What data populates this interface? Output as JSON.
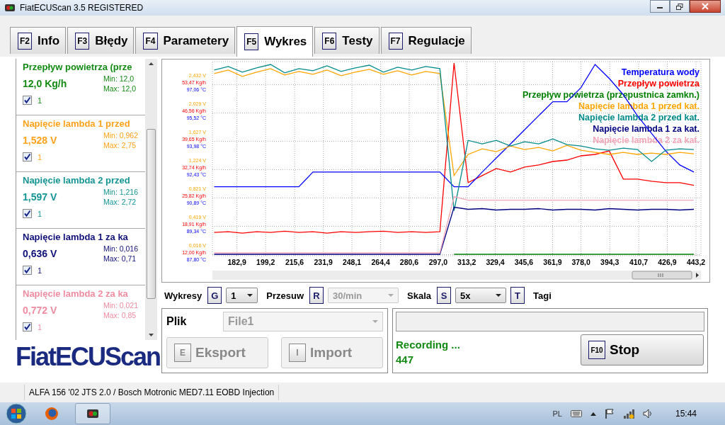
{
  "window": {
    "title": "FiatECUScan 3.5 REGISTERED"
  },
  "tabs": [
    {
      "key": "F2",
      "label": "Info",
      "selected": false
    },
    {
      "key": "F3",
      "label": "Błędy",
      "selected": false
    },
    {
      "key": "F4",
      "label": "Parametery",
      "selected": false
    },
    {
      "key": "F5",
      "label": "Wykres",
      "selected": true
    },
    {
      "key": "F6",
      "label": "Testy",
      "selected": false
    },
    {
      "key": "F7",
      "label": "Regulacje",
      "selected": false
    }
  ],
  "parameters": [
    {
      "name": "Przepływ powietrza (prze",
      "value": "12,0 Kg/h",
      "min": "Min: 12,0",
      "max": "Max: 12,0",
      "checked": true,
      "index": "1",
      "color": "#138a13"
    },
    {
      "name": "Napięcie lambda 1 przed",
      "value": "1,528 V",
      "min": "Min: 0,962",
      "max": "Max: 2,75",
      "checked": true,
      "index": "1",
      "color": "#ffa21a"
    },
    {
      "name": "Napięcie lambda 2 przed",
      "value": "1,597 V",
      "min": "Min: 1,216",
      "max": "Max: 2,72",
      "checked": true,
      "index": "1",
      "color": "#149494"
    },
    {
      "name": "Napięcie lambda 1 za ka",
      "value": "0,636 V",
      "min": "Min: 0,016",
      "max": "Max: 0,71",
      "checked": true,
      "index": "1",
      "color": "#10107a"
    },
    {
      "name": "Napięcie lambda 2 za ka",
      "value": "0,772 V",
      "min": "Min: 0,021",
      "max": "Max: 0,85",
      "checked": true,
      "index": "1",
      "color": "#f08ca0"
    }
  ],
  "logo": "FiatECUScan",
  "chart": {
    "chart_data": {
      "type": "line",
      "x": [
        170,
        178,
        186,
        194,
        202,
        210,
        218,
        226,
        234,
        242,
        250,
        258,
        266,
        274,
        282,
        290,
        298,
        306,
        314,
        322,
        330,
        338,
        346,
        354,
        362,
        370,
        378,
        386,
        394,
        402,
        410,
        418,
        426,
        434,
        442
      ],
      "series": [
        {
          "name": "Temperatura wody",
          "color": "#0000ff",
          "values": [
            0.84,
            0.84,
            0.84,
            0.84,
            0.84,
            0.84,
            0.84,
            1.05,
            1.05,
            1.05,
            1.05,
            1.05,
            1.05,
            1.05,
            1.05,
            1.05,
            1.05,
            0.84,
            0.84,
            1.05,
            1.25,
            1.45,
            1.65,
            1.85,
            2.05,
            2.05,
            2.25,
            2.58,
            2.38,
            2.15,
            1.85,
            1.6,
            1.35,
            1.15,
            1.05
          ]
        },
        {
          "name": "Przepływ powietrza",
          "color": "#ff0000",
          "values": [
            0.19,
            0.2,
            0.18,
            0.2,
            0.19,
            0.21,
            0.19,
            0.2,
            0.18,
            0.2,
            0.19,
            0.2,
            0.21,
            0.19,
            0.2,
            0.19,
            0.2,
            2.6,
            0.9,
            1.0,
            1.1,
            1.05,
            1.12,
            1.15,
            1.2,
            1.22,
            1.28,
            1.3,
            1.35,
            0.95,
            0.95,
            0.92,
            0.9,
            0.9,
            0.86
          ]
        },
        {
          "name": "Przepływ powietrza (przepustnica zamkn.)",
          "color": "#008000",
          "values": [
            null,
            null,
            null,
            null,
            null,
            null,
            null,
            null,
            null,
            null,
            null,
            null,
            null,
            null,
            null,
            null,
            null,
            -0.12,
            -0.12,
            -0.12,
            -0.12,
            -0.12,
            -0.12,
            -0.12,
            -0.12,
            -0.12,
            -0.12,
            -0.12,
            -0.12,
            -0.12,
            -0.12,
            -0.12,
            -0.12,
            -0.12,
            -0.12
          ]
        },
        {
          "name": "Napięcie lambda 1 przed kat.",
          "color": "#ffa500",
          "values": [
            2.45,
            2.5,
            2.41,
            2.47,
            2.52,
            2.43,
            2.48,
            2.44,
            2.5,
            2.42,
            2.47,
            2.51,
            2.44,
            2.49,
            2.43,
            2.48,
            2.45,
            1.0,
            1.3,
            1.38,
            1.34,
            1.42,
            1.37,
            1.4,
            1.35,
            1.43,
            1.36,
            1.33,
            1.3,
            1.33,
            1.3,
            1.32,
            1.3,
            1.33,
            1.31
          ]
        },
        {
          "name": "Napięcie lambda 2 przed kat.",
          "color": "#008b8b",
          "values": [
            2.5,
            2.55,
            2.47,
            2.53,
            2.58,
            2.46,
            2.52,
            2.49,
            2.56,
            2.48,
            2.53,
            2.57,
            2.47,
            2.54,
            2.5,
            2.55,
            2.52,
            0.5,
            1.5,
            1.45,
            1.5,
            1.42,
            1.48,
            1.45,
            1.52,
            1.44,
            1.42,
            1.38,
            1.36,
            1.39,
            1.37,
            1.2,
            1.36,
            1.38,
            1.37
          ]
        },
        {
          "name": "Napięcie lambda 1 za kat.",
          "color": "#000080",
          "values": [
            -0.12,
            -0.12,
            -0.12,
            -0.12,
            -0.12,
            -0.12,
            -0.12,
            -0.12,
            -0.12,
            -0.12,
            -0.12,
            -0.12,
            -0.12,
            -0.12,
            -0.12,
            -0.12,
            -0.12,
            0.55,
            0.52,
            0.53,
            0.51,
            0.52,
            0.52,
            0.53,
            0.51,
            0.52,
            0.52,
            0.51,
            0.53,
            0.52,
            0.51,
            0.52,
            0.52,
            0.51,
            0.52
          ]
        },
        {
          "name": "Napięcie lambda 2 za kat.",
          "color": "#f4a6b8",
          "values": [
            -0.1,
            -0.1,
            -0.1,
            -0.1,
            -0.1,
            -0.1,
            -0.1,
            -0.1,
            -0.1,
            -0.1,
            -0.1,
            -0.1,
            -0.1,
            -0.1,
            -0.1,
            -0.1,
            -0.1,
            0.7,
            0.65,
            0.65,
            0.65,
            0.65,
            0.65,
            0.65,
            0.65,
            0.65,
            0.65,
            0.65,
            0.65,
            0.65,
            0.65,
            0.65,
            0.65,
            0.65,
            0.65
          ]
        }
      ],
      "grid": true,
      "xlim": [
        169,
        446
      ],
      "ylim": [
        -0.14,
        2.62
      ],
      "xticks": [
        {
          "value": 182.9,
          "label": "182,9"
        },
        {
          "value": 199.2,
          "label": "199,2"
        },
        {
          "value": 215.6,
          "label": "215,6"
        },
        {
          "value": 231.9,
          "label": "231,9"
        },
        {
          "value": 248.1,
          "label": "248,1"
        },
        {
          "value": 264.4,
          "label": "264,4"
        },
        {
          "value": 280.6,
          "label": "280,6"
        },
        {
          "value": 297.0,
          "label": "297,0"
        },
        {
          "value": 313.2,
          "label": "313,2"
        },
        {
          "value": 329.4,
          "label": "329,4"
        },
        {
          "value": 345.6,
          "label": "345,6"
        },
        {
          "value": 361.9,
          "label": "361,9"
        },
        {
          "value": 378.0,
          "label": "378,0"
        },
        {
          "value": 394.3,
          "label": "394,3"
        },
        {
          "value": 410.7,
          "label": "410,7"
        },
        {
          "value": 426.9,
          "label": "426,9"
        },
        {
          "value": 443.2,
          "label": "443,2"
        }
      ],
      "yticks": [
        {
          "value": 2.432,
          "label": "2,432 V"
        },
        {
          "value": 2.029,
          "label": "2,029 V"
        },
        {
          "value": 1.627,
          "label": "1,627 V"
        },
        {
          "value": 1.224,
          "label": "1,224 V"
        },
        {
          "value": 0.821,
          "label": "0,821 V"
        },
        {
          "value": 0.419,
          "label": "0,419 V"
        },
        {
          "value": 0.016,
          "label": "0,016 V"
        }
      ]
    },
    "flow_tick_labels": [
      "53,47 Kg/h",
      "46,56 Kg/h",
      "39,65 Kg/h",
      "32,74 Kg/h",
      "25,82 Kg/h",
      "18,91 Kg/h",
      "12,00 Kg/h"
    ],
    "temp_tick_labels": [
      "97,06 °C",
      "95,52 °C",
      "93,98 °C",
      "92,43 °C",
      "90,89 °C",
      "89,34 °C",
      "87,80 °C"
    ]
  },
  "toolbar": [
    {
      "kind": "label",
      "text": "Wykresy"
    },
    {
      "kind": "key",
      "text": "G"
    },
    {
      "kind": "select",
      "text": "1",
      "disabled": false
    },
    {
      "kind": "label",
      "text": "Przesuw"
    },
    {
      "kind": "key",
      "text": "R"
    },
    {
      "kind": "select",
      "text": "30/min",
      "disabled": true
    },
    {
      "kind": "label",
      "text": "Skala"
    },
    {
      "kind": "key",
      "text": "S"
    },
    {
      "kind": "select",
      "text": "5x",
      "disabled": false
    },
    {
      "kind": "key",
      "text": "T"
    },
    {
      "kind": "label",
      "text": "Tagi"
    }
  ],
  "file_panel": {
    "label": "Plik",
    "file": "File1",
    "file_disabled": true,
    "buttons": [
      {
        "key": "E",
        "label": "Eksport",
        "disabled": true
      },
      {
        "key": "I",
        "label": "Import",
        "disabled": true
      }
    ]
  },
  "record_panel": {
    "status": "Recording ...",
    "count": "447",
    "stop_key": "F10",
    "stop_label": "Stop"
  },
  "status_bar": "ALFA 156 '02 JTS 2.0 / Bosch Motronic MED7.11 EOBD Injection",
  "taskbar": {
    "language": "PL",
    "clock": "15:44"
  }
}
